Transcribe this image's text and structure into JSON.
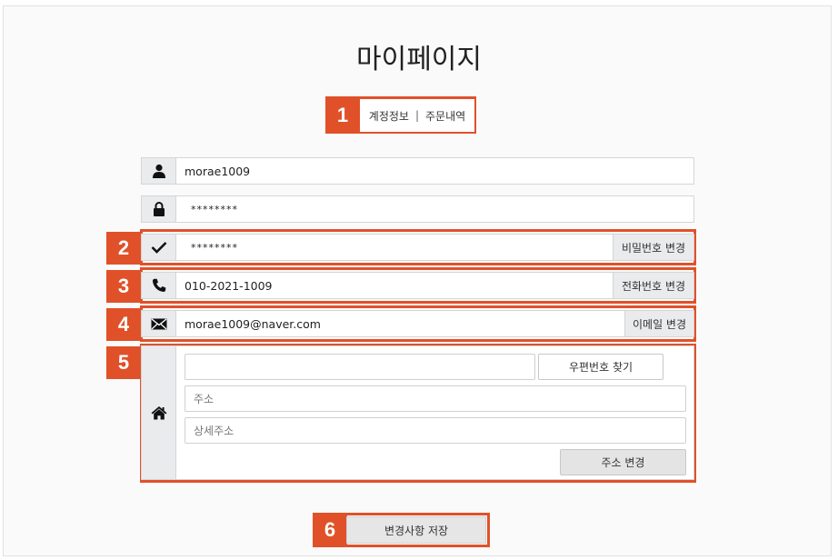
{
  "page": {
    "title": "마이페이지"
  },
  "tabs": {
    "account": "계정정보",
    "separator": "|",
    "orders": "주문내역"
  },
  "badges": [
    "1",
    "2",
    "3",
    "4",
    "5",
    "6"
  ],
  "fields": {
    "username": {
      "value": "morae1009",
      "icon": "user-icon"
    },
    "password": {
      "value": "********",
      "icon": "lock-icon"
    },
    "password_confirm": {
      "value": "********",
      "icon": "check-icon",
      "button": "비밀번호 변경"
    },
    "phone": {
      "value": "010-2021-1009",
      "icon": "phone-icon",
      "button": "전화번호 변경"
    },
    "email": {
      "value": "morae1009@naver.com",
      "icon": "envelope-icon",
      "button": "이메일 변경"
    }
  },
  "address": {
    "icon": "home-icon",
    "postcode_value": "",
    "postcode_button": "우편번호 찾기",
    "address_placeholder": "주소",
    "detail_placeholder": "상세주소",
    "change_button": "주소 변경"
  },
  "save_button": "변경사항 저장",
  "colors": {
    "highlight": "#e0512a",
    "icon_bg": "#e9ebed"
  }
}
